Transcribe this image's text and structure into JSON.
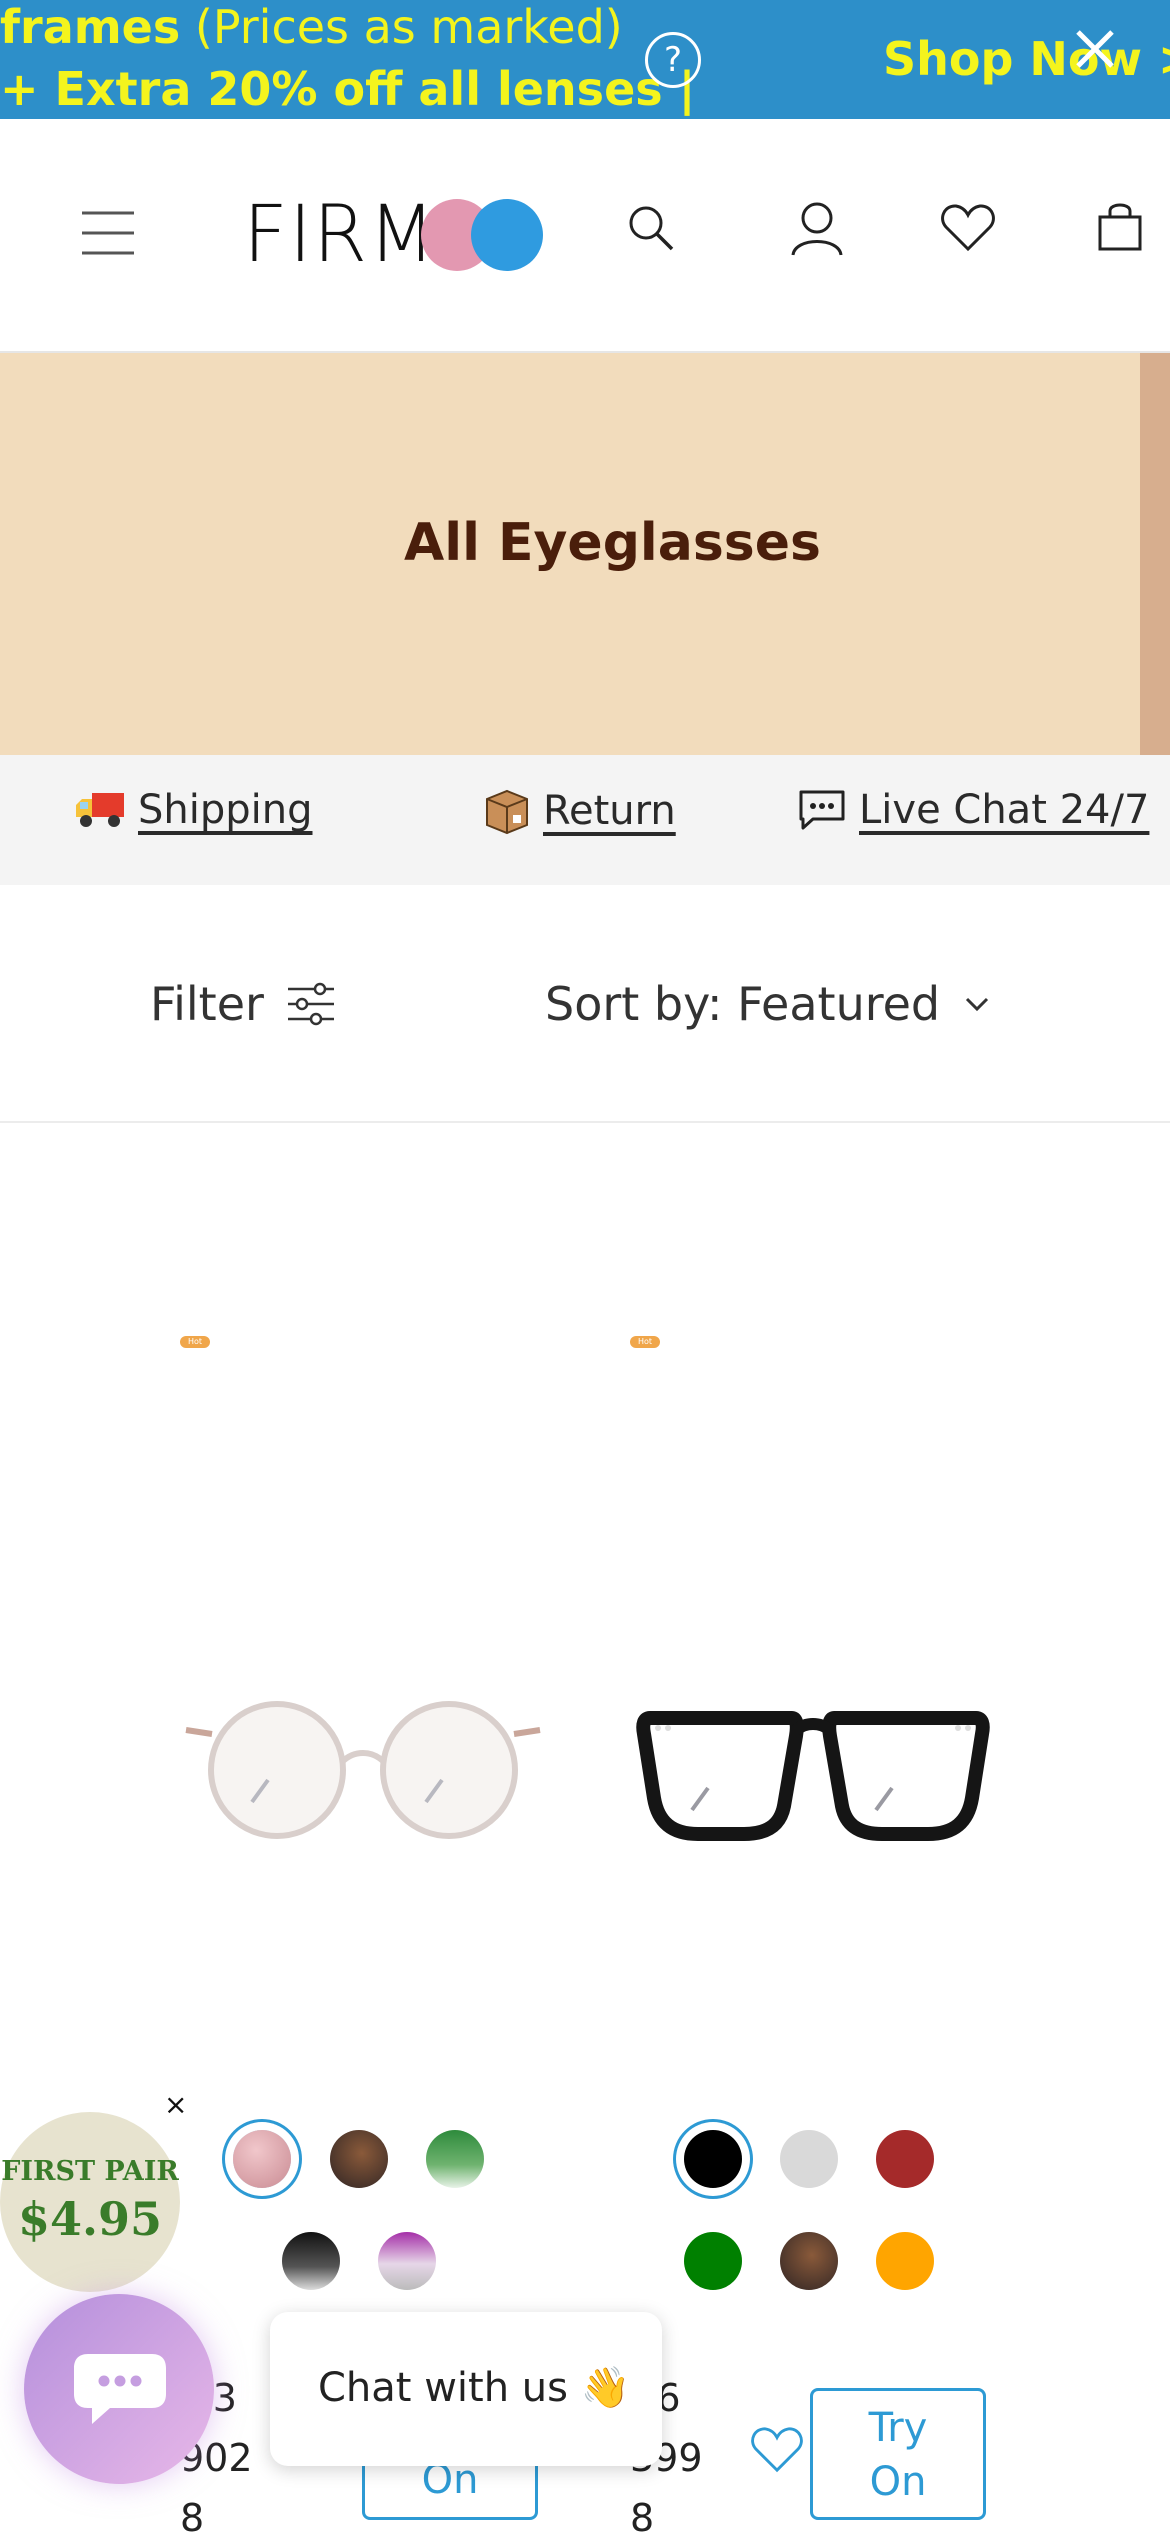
{
  "promo": {
    "line1_bold": "frames",
    "line1_rest": " (Prices as marked)",
    "line2": "+ Extra 20% off all lenses |",
    "help_symbol": "?",
    "shop_now": "Shop Now >"
  },
  "header": {
    "logo_text": "FIRM"
  },
  "banner": {
    "title": "All Eyeglasses"
  },
  "service": {
    "shipping": "Shipping",
    "return": "Return",
    "live_chat": "Live Chat 24/7"
  },
  "toolbar": {
    "filter": "Filter",
    "sort": "Sort by: Featured"
  },
  "products": [
    {
      "badge": "Hot",
      "name_lines": [
        "M3",
        "902",
        "8"
      ],
      "try_on": "On",
      "swatch_colors": [
        "#d89a9f",
        "#4a3530",
        "#2e8b3c",
        "#111111",
        "#a52fa8"
      ]
    },
    {
      "badge": "Hot",
      "name_lines": [
        "R6",
        "399",
        "8"
      ],
      "try_on_line1": "Try",
      "try_on_line2": "On",
      "swatch_colors": [
        "#000000",
        "#d9d9d9",
        "#a52a2a",
        "#008000",
        "#4a3530",
        "#ffa500"
      ]
    }
  ],
  "first_pair": {
    "label": "FIRST PAIR",
    "price": "$4.95",
    "close": "×"
  },
  "chat": {
    "popup_text": "Chat with us 👋"
  }
}
